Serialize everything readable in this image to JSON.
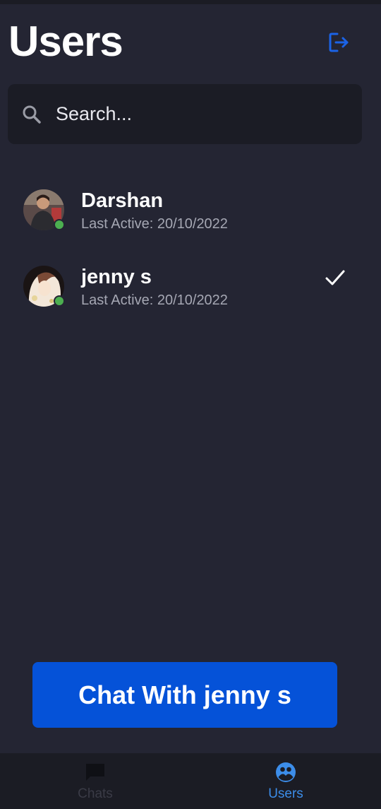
{
  "header": {
    "title": "Users",
    "logout_icon": "logout-icon"
  },
  "search": {
    "placeholder": "Search...",
    "value": "",
    "icon": "search-icon"
  },
  "users": [
    {
      "name": "Darshan",
      "last_active": "Last Active: 20/10/2022",
      "online": true,
      "selected": false
    },
    {
      "name": "jenny s",
      "last_active": "Last Active: 20/10/2022",
      "online": true,
      "selected": true
    }
  ],
  "action_button": {
    "label": "Chat With jenny s"
  },
  "bottom_nav": {
    "items": [
      {
        "label": "Chats",
        "icon": "chat-icon",
        "active": false
      },
      {
        "label": "Users",
        "icon": "users-icon",
        "active": true
      }
    ]
  },
  "colors": {
    "background": "#242533",
    "surface": "#1b1c24",
    "accent": "#0552d8",
    "active_nav": "#3c8de9",
    "online": "#4caf50"
  }
}
